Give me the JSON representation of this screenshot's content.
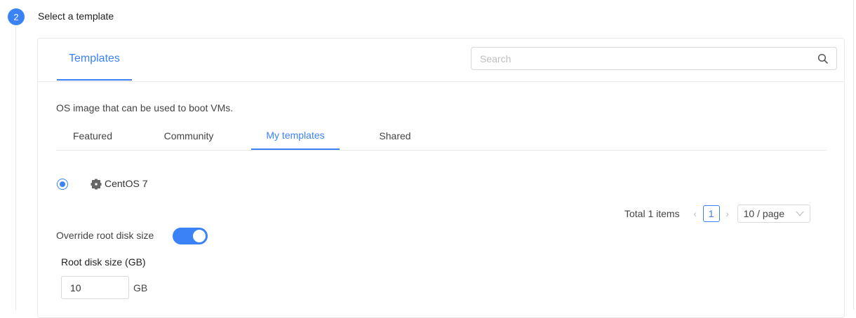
{
  "step": {
    "number": "2",
    "title": "Select a template"
  },
  "header": {
    "tab_label": "Templates",
    "search": {
      "placeholder": "Search",
      "value": ""
    }
  },
  "description": "OS image that can be used to boot VMs.",
  "subtabs": [
    {
      "label": "Featured",
      "active": false
    },
    {
      "label": "Community",
      "active": false
    },
    {
      "label": "My templates",
      "active": true
    },
    {
      "label": "Shared",
      "active": false
    }
  ],
  "templates": [
    {
      "name": "CentOS 7",
      "selected": true,
      "icon": "centos-icon"
    }
  ],
  "pagination": {
    "total_text": "Total 1 items",
    "current_page": "1",
    "page_size": "10 / page"
  },
  "disk": {
    "override_label": "Override root disk size",
    "override_enabled": true,
    "size_label": "Root disk size (GB)",
    "size_value": "10",
    "unit": "GB"
  },
  "colors": {
    "accent": "#3b82f6",
    "border": "#e8e8e8"
  }
}
